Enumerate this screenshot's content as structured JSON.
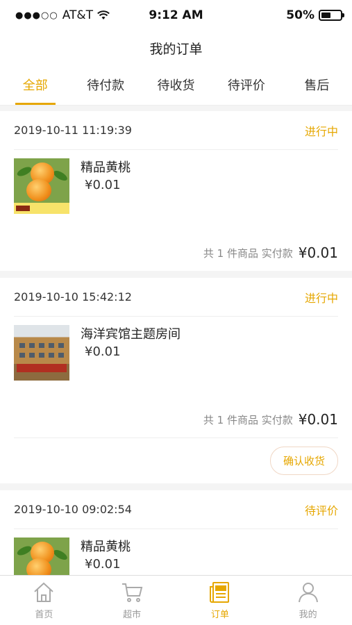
{
  "status_bar": {
    "carrier": "AT&T",
    "time": "9:12 AM",
    "battery": "50%",
    "battery_level": 0.5
  },
  "header": {
    "title": "我的订单"
  },
  "tabs": [
    {
      "label": "全部",
      "active": true
    },
    {
      "label": "待付款",
      "active": false
    },
    {
      "label": "待收货",
      "active": false
    },
    {
      "label": "待评价",
      "active": false
    },
    {
      "label": "售后",
      "active": false
    }
  ],
  "orders": [
    {
      "time": "2019-10-11 11:19:39",
      "status": "进行中",
      "item_name": "精品黄桃",
      "price": "¥0.01",
      "summary": "共 1 件商品 实付款",
      "total": "¥0.01"
    },
    {
      "time": "2019-10-10 15:42:12",
      "status": "进行中",
      "item_name": "海洋宾馆主题房间",
      "price": "¥0.01",
      "summary": "共 1 件商品 实付款",
      "total": "¥0.01",
      "action": "确认收货"
    },
    {
      "time": "2019-10-10 09:02:54",
      "status": "待评价",
      "item_name": "精品黄桃",
      "price": "¥0.01"
    }
  ],
  "tabbar": [
    {
      "label": "首页",
      "icon": "home-icon",
      "active": false
    },
    {
      "label": "超市",
      "icon": "cart-icon",
      "active": false
    },
    {
      "label": "订单",
      "icon": "order-icon",
      "active": true
    },
    {
      "label": "我的",
      "icon": "user-icon",
      "active": false
    }
  ],
  "colors": {
    "accent": "#e6a700",
    "background": "#f4f4f4"
  }
}
